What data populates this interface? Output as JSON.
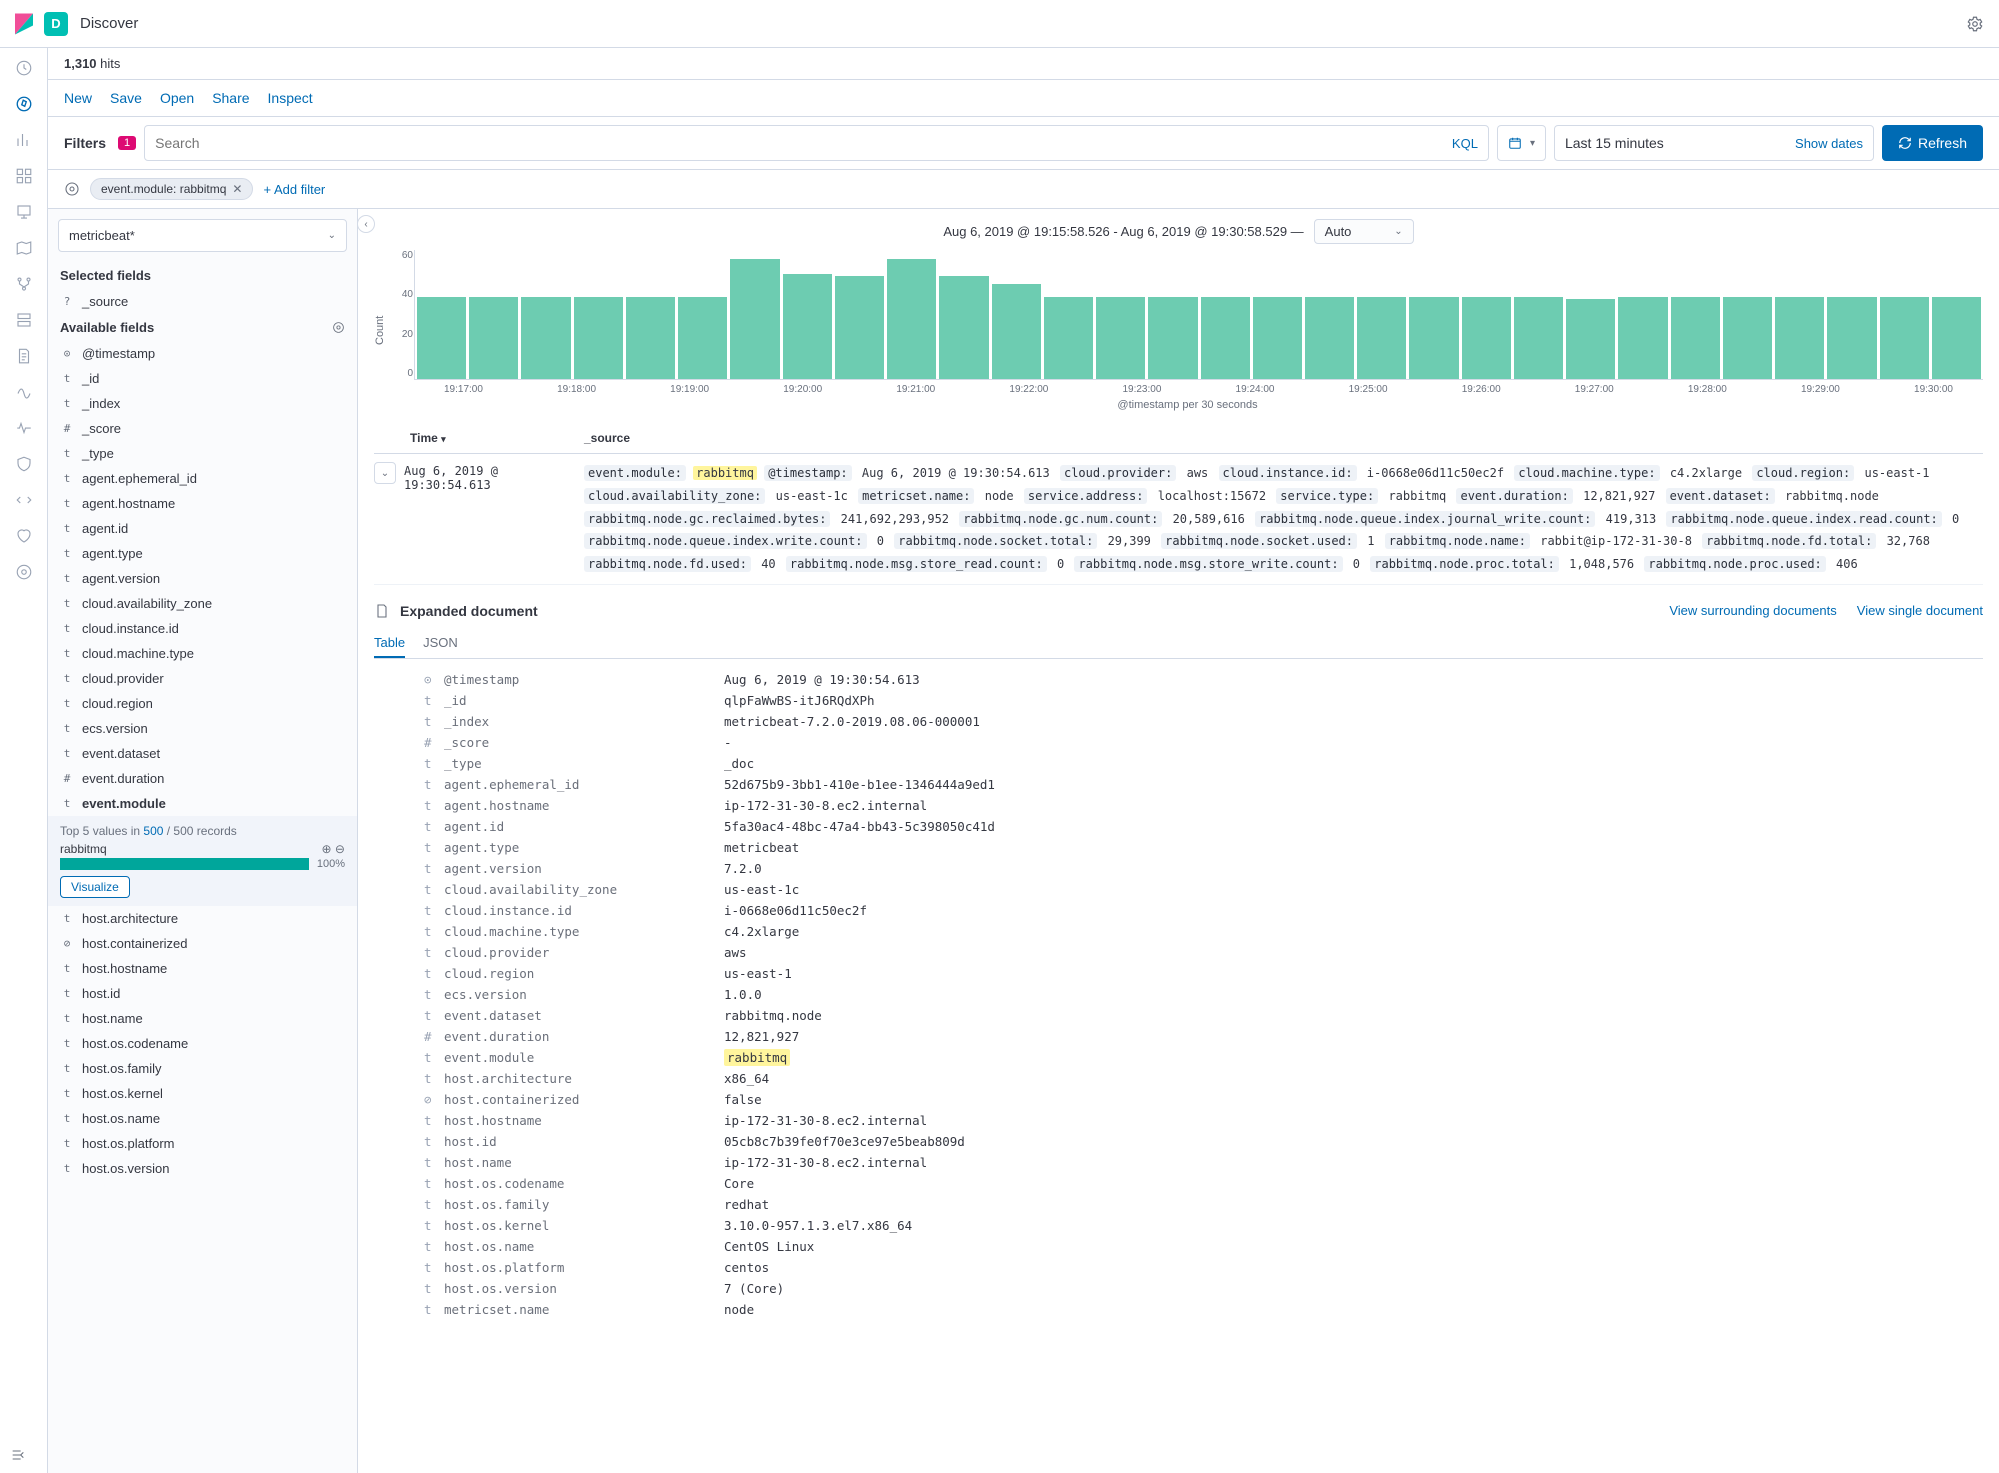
{
  "header": {
    "app_badge": "D",
    "breadcrumb": "Discover"
  },
  "hits": {
    "count": "1,310",
    "label": "hits"
  },
  "actions": {
    "new": "New",
    "save": "Save",
    "open": "Open",
    "share": "Share",
    "inspect": "Inspect"
  },
  "filters": {
    "label": "Filters",
    "count": "1",
    "search_placeholder": "Search",
    "kql": "KQL",
    "date_range": "Last 15 minutes",
    "show_dates": "Show dates",
    "refresh": "Refresh",
    "pill": "event.module: rabbitmq",
    "add_filter": "+ Add filter"
  },
  "sidebar": {
    "index_pattern": "metricbeat*",
    "selected_label": "Selected fields",
    "selected": [
      {
        "type": "?",
        "name": "_source"
      }
    ],
    "available_label": "Available fields",
    "available": [
      {
        "type": "⊙",
        "name": "@timestamp"
      },
      {
        "type": "t",
        "name": "_id"
      },
      {
        "type": "t",
        "name": "_index"
      },
      {
        "type": "#",
        "name": "_score"
      },
      {
        "type": "t",
        "name": "_type"
      },
      {
        "type": "t",
        "name": "agent.ephemeral_id"
      },
      {
        "type": "t",
        "name": "agent.hostname"
      },
      {
        "type": "t",
        "name": "agent.id"
      },
      {
        "type": "t",
        "name": "agent.type"
      },
      {
        "type": "t",
        "name": "agent.version"
      },
      {
        "type": "t",
        "name": "cloud.availability_zone"
      },
      {
        "type": "t",
        "name": "cloud.instance.id"
      },
      {
        "type": "t",
        "name": "cloud.machine.type"
      },
      {
        "type": "t",
        "name": "cloud.provider"
      },
      {
        "type": "t",
        "name": "cloud.region"
      },
      {
        "type": "t",
        "name": "ecs.version"
      },
      {
        "type": "t",
        "name": "event.dataset"
      },
      {
        "type": "#",
        "name": "event.duration"
      },
      {
        "type": "t",
        "name": "event.module",
        "expanded": true
      },
      {
        "type": "t",
        "name": "host.architecture"
      },
      {
        "type": "⊘",
        "name": "host.containerized"
      },
      {
        "type": "t",
        "name": "host.hostname"
      },
      {
        "type": "t",
        "name": "host.id"
      },
      {
        "type": "t",
        "name": "host.name"
      },
      {
        "type": "t",
        "name": "host.os.codename"
      },
      {
        "type": "t",
        "name": "host.os.family"
      },
      {
        "type": "t",
        "name": "host.os.kernel"
      },
      {
        "type": "t",
        "name": "host.os.name"
      },
      {
        "type": "t",
        "name": "host.os.platform"
      },
      {
        "type": "t",
        "name": "host.os.version"
      }
    ],
    "field_expand": {
      "top5_prefix": "Top 5 values in ",
      "top5_count": "500",
      "top5_suffix": " / 500 records",
      "value": "rabbitmq",
      "pct": "100%",
      "visualize": "Visualize"
    }
  },
  "chart_data": {
    "type": "bar",
    "title_range": "Aug 6, 2019 @ 19:15:58.526 - Aug 6, 2019 @ 19:30:58.529 —",
    "interval": "Auto",
    "ylabel": "Count",
    "xlabel": "@timestamp per 30 seconds",
    "ylim": [
      0,
      60
    ],
    "yticks": [
      "60",
      "40",
      "20",
      "0"
    ],
    "xticks": [
      "19:17:00",
      "19:18:00",
      "19:19:00",
      "19:20:00",
      "19:21:00",
      "19:22:00",
      "19:23:00",
      "19:24:00",
      "19:25:00",
      "19:26:00",
      "19:27:00",
      "19:28:00",
      "19:29:00",
      "19:30:00"
    ],
    "values": [
      38,
      38,
      38,
      38,
      38,
      38,
      56,
      49,
      48,
      56,
      48,
      44,
      38,
      38,
      38,
      38,
      38,
      38,
      38,
      38,
      38,
      38,
      37,
      38,
      38,
      38,
      38,
      38,
      38,
      38
    ]
  },
  "table": {
    "time_col": "Time",
    "source_col": "_source",
    "doc_time": "Aug 6, 2019 @ 19:30:54.613",
    "source_pairs": [
      {
        "k": "event.module:",
        "v": "rabbitmq",
        "hl": true
      },
      {
        "k": "@timestamp:",
        "v": "Aug 6, 2019 @ 19:30:54.613"
      },
      {
        "k": "cloud.provider:",
        "v": "aws"
      },
      {
        "k": "cloud.instance.id:",
        "v": "i-0668e06d11c50ec2f"
      },
      {
        "k": "cloud.machine.type:",
        "v": "c4.2xlarge"
      },
      {
        "k": "cloud.region:",
        "v": "us-east-1"
      },
      {
        "k": "cloud.availability_zone:",
        "v": "us-east-1c"
      },
      {
        "k": "metricset.name:",
        "v": "node"
      },
      {
        "k": "service.address:",
        "v": "localhost:15672"
      },
      {
        "k": "service.type:",
        "v": "rabbitmq"
      },
      {
        "k": "event.duration:",
        "v": "12,821,927"
      },
      {
        "k": "event.dataset:",
        "v": "rabbitmq.node"
      },
      {
        "k": "rabbitmq.node.gc.reclaimed.bytes:",
        "v": "241,692,293,952"
      },
      {
        "k": "rabbitmq.node.gc.num.count:",
        "v": "20,589,616"
      },
      {
        "k": "rabbitmq.node.queue.index.journal_write.count:",
        "v": "419,313"
      },
      {
        "k": "rabbitmq.node.queue.index.read.count:",
        "v": "0"
      },
      {
        "k": "rabbitmq.node.queue.index.write.count:",
        "v": "0"
      },
      {
        "k": "rabbitmq.node.socket.total:",
        "v": "29,399"
      },
      {
        "k": "rabbitmq.node.socket.used:",
        "v": "1"
      },
      {
        "k": "rabbitmq.node.name:",
        "v": "rabbit@ip-172-31-30-8"
      },
      {
        "k": "rabbitmq.node.fd.total:",
        "v": "32,768"
      },
      {
        "k": "rabbitmq.node.fd.used:",
        "v": "40"
      },
      {
        "k": "rabbitmq.node.msg.store_read.count:",
        "v": "0"
      },
      {
        "k": "rabbitmq.node.msg.store_write.count:",
        "v": "0"
      },
      {
        "k": "rabbitmq.node.proc.total:",
        "v": "1,048,576"
      },
      {
        "k": "rabbitmq.node.proc.used:",
        "v": "406"
      }
    ]
  },
  "expanded": {
    "title": "Expanded document",
    "link_surrounding": "View surrounding documents",
    "link_single": "View single document",
    "tab_table": "Table",
    "tab_json": "JSON",
    "rows": [
      {
        "t": "⊙",
        "n": "@timestamp",
        "v": "Aug 6, 2019 @ 19:30:54.613"
      },
      {
        "t": "t",
        "n": "_id",
        "v": "qlpFaWwBS-itJ6RQdXPh"
      },
      {
        "t": "t",
        "n": "_index",
        "v": "metricbeat-7.2.0-2019.08.06-000001"
      },
      {
        "t": "#",
        "n": "_score",
        "v": "-"
      },
      {
        "t": "t",
        "n": "_type",
        "v": "_doc"
      },
      {
        "t": "t",
        "n": "agent.ephemeral_id",
        "v": "52d675b9-3bb1-410e-b1ee-1346444a9ed1"
      },
      {
        "t": "t",
        "n": "agent.hostname",
        "v": "ip-172-31-30-8.ec2.internal"
      },
      {
        "t": "t",
        "n": "agent.id",
        "v": "5fa30ac4-48bc-47a4-bb43-5c398050c41d"
      },
      {
        "t": "t",
        "n": "agent.type",
        "v": "metricbeat"
      },
      {
        "t": "t",
        "n": "agent.version",
        "v": "7.2.0"
      },
      {
        "t": "t",
        "n": "cloud.availability_zone",
        "v": "us-east-1c"
      },
      {
        "t": "t",
        "n": "cloud.instance.id",
        "v": "i-0668e06d11c50ec2f"
      },
      {
        "t": "t",
        "n": "cloud.machine.type",
        "v": "c4.2xlarge"
      },
      {
        "t": "t",
        "n": "cloud.provider",
        "v": "aws"
      },
      {
        "t": "t",
        "n": "cloud.region",
        "v": "us-east-1"
      },
      {
        "t": "t",
        "n": "ecs.version",
        "v": "1.0.0"
      },
      {
        "t": "t",
        "n": "event.dataset",
        "v": "rabbitmq.node"
      },
      {
        "t": "#",
        "n": "event.duration",
        "v": "12,821,927"
      },
      {
        "t": "t",
        "n": "event.module",
        "v": "rabbitmq",
        "hl": true
      },
      {
        "t": "t",
        "n": "host.architecture",
        "v": "x86_64"
      },
      {
        "t": "⊘",
        "n": "host.containerized",
        "v": "false"
      },
      {
        "t": "t",
        "n": "host.hostname",
        "v": "ip-172-31-30-8.ec2.internal"
      },
      {
        "t": "t",
        "n": "host.id",
        "v": "05cb8c7b39fe0f70e3ce97e5beab809d"
      },
      {
        "t": "t",
        "n": "host.name",
        "v": "ip-172-31-30-8.ec2.internal"
      },
      {
        "t": "t",
        "n": "host.os.codename",
        "v": "Core"
      },
      {
        "t": "t",
        "n": "host.os.family",
        "v": "redhat"
      },
      {
        "t": "t",
        "n": "host.os.kernel",
        "v": "3.10.0-957.1.3.el7.x86_64"
      },
      {
        "t": "t",
        "n": "host.os.name",
        "v": "CentOS Linux"
      },
      {
        "t": "t",
        "n": "host.os.platform",
        "v": "centos"
      },
      {
        "t": "t",
        "n": "host.os.version",
        "v": "7 (Core)"
      },
      {
        "t": "t",
        "n": "metricset.name",
        "v": "node"
      }
    ]
  }
}
